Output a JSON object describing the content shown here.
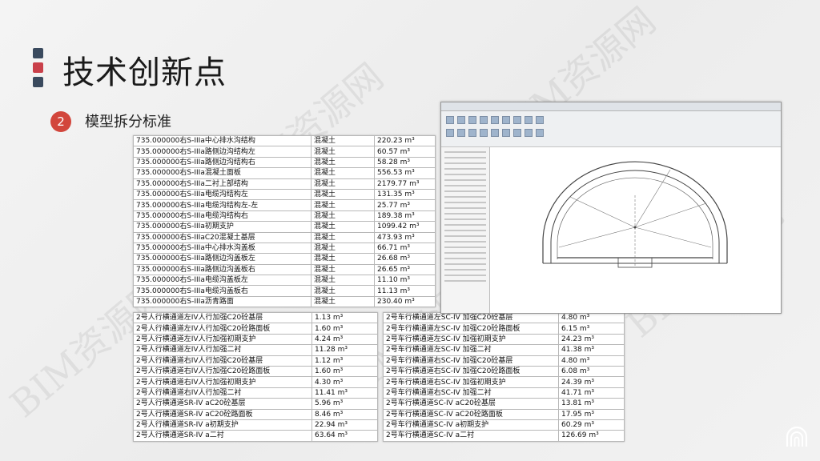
{
  "title": "技术创新点",
  "section": {
    "number": "2",
    "label": "模型拆分标准"
  },
  "watermark": "BIM资源网",
  "table_top": [
    [
      "735.000000右S-IIIa中心排水沟结构",
      "混凝土",
      "220.23 m³"
    ],
    [
      "735.000000右S-IIIa路侧边沟结构左",
      "混凝土",
      "60.57 m³"
    ],
    [
      "735.000000右S-IIIa路侧边沟结构右",
      "混凝土",
      "58.28 m³"
    ],
    [
      "735.000000右S-IIIa混凝土面板",
      "混凝土",
      "556.53 m³"
    ],
    [
      "735.000000右S-IIIa二衬上部结构",
      "混凝土",
      "2179.77 m³"
    ],
    [
      "735.000000右S-IIIa电缆沟结构左",
      "混凝土",
      "131.35 m³"
    ],
    [
      "735.000000右S-IIIa电缆沟结构左-左",
      "混凝土",
      "25.77 m³"
    ],
    [
      "735.000000右S-IIIa电缆沟结构右",
      "混凝土",
      "189.38 m³"
    ],
    [
      "735.000000右S-IIIa初期支护",
      "混凝土",
      "1099.42 m³"
    ],
    [
      "735.000000右S-IIIaC20混凝土基层",
      "混凝土",
      "473.93 m³"
    ],
    [
      "735.000000右S-IIIa中心排水沟盖板",
      "混凝土",
      "66.71 m³"
    ],
    [
      "735.000000右S-IIIa路侧边沟盖板左",
      "混凝土",
      "26.68 m³"
    ],
    [
      "735.000000右S-IIIa路侧边沟盖板右",
      "混凝土",
      "26.65 m³"
    ],
    [
      "735.000000右S-IIIa电缆沟盖板左",
      "混凝土",
      "11.10 m³"
    ],
    [
      "735.000000右S-IIIa电缆沟盖板右",
      "混凝土",
      "11.13 m³"
    ],
    [
      "735.000000右S-IIIa沥青路面",
      "混凝土",
      "230.40 m³"
    ]
  ],
  "table_left": [
    [
      "2号人行横通道左IV人行加强C20砼基层",
      "1.13 m³"
    ],
    [
      "2号人行横通道左IV人行加强C20砼路面板",
      "1.60 m³"
    ],
    [
      "2号人行横通道左IV人行加强初期支护",
      "4.24 m³"
    ],
    [
      "2号人行横通道左IV人行加强二衬",
      "11.28 m³"
    ],
    [
      "2号人行横通道右IV人行加强C20砼基层",
      "1.12 m³"
    ],
    [
      "2号人行横通道右IV人行加强C20砼路面板",
      "1.60 m³"
    ],
    [
      "2号人行横通道右IV人行加强初期支护",
      "4.30 m³"
    ],
    [
      "2号人行横通道右IV人行加强二衬",
      "11.41 m³"
    ],
    [
      "2号人行横通道SR-IV aC20砼基层",
      "5.96 m³"
    ],
    [
      "2号人行横通道SR-IV aC20砼路面板",
      "8.46 m³"
    ],
    [
      "2号人行横通道SR-IV a初期支护",
      "22.94 m³"
    ],
    [
      "2号人行横通道SR-IV a二衬",
      "63.64 m³"
    ]
  ],
  "table_right": [
    [
      "2号车行横通道左SC-IV 加强C20砼基层",
      "4.80 m³"
    ],
    [
      "2号车行横通道左SC-IV 加强C20砼路面板",
      "6.15 m³"
    ],
    [
      "2号车行横通道左SC-IV 加强初期支护",
      "24.23 m³"
    ],
    [
      "2号车行横通道左SC-IV 加强二衬",
      "41.38 m³"
    ],
    [
      "2号车行横通道右SC-IV 加强C20砼基层",
      "4.80 m³"
    ],
    [
      "2号车行横通道右SC-IV 加强C20砼路面板",
      "6.08 m³"
    ],
    [
      "2号车行横通道右SC-IV 加强初期支护",
      "24.39 m³"
    ],
    [
      "2号车行横通道右SC-IV 加强二衬",
      "41.71 m³"
    ],
    [
      "2号车行横通道SC-IV aC20砼基层",
      "13.81 m³"
    ],
    [
      "2号车行横通道SC-IV aC20砼路面板",
      "17.95 m³"
    ],
    [
      "2号车行横通道SC-IV a初期支护",
      "60.29 m³"
    ],
    [
      "2号车行横通道SC-IV a二衬",
      "126.69 m³"
    ]
  ],
  "colors": {
    "accent_red": "#d2463c",
    "deco_blue": "#3a4a5e"
  },
  "icons": {
    "logo": "tunnel-arch-logo"
  }
}
